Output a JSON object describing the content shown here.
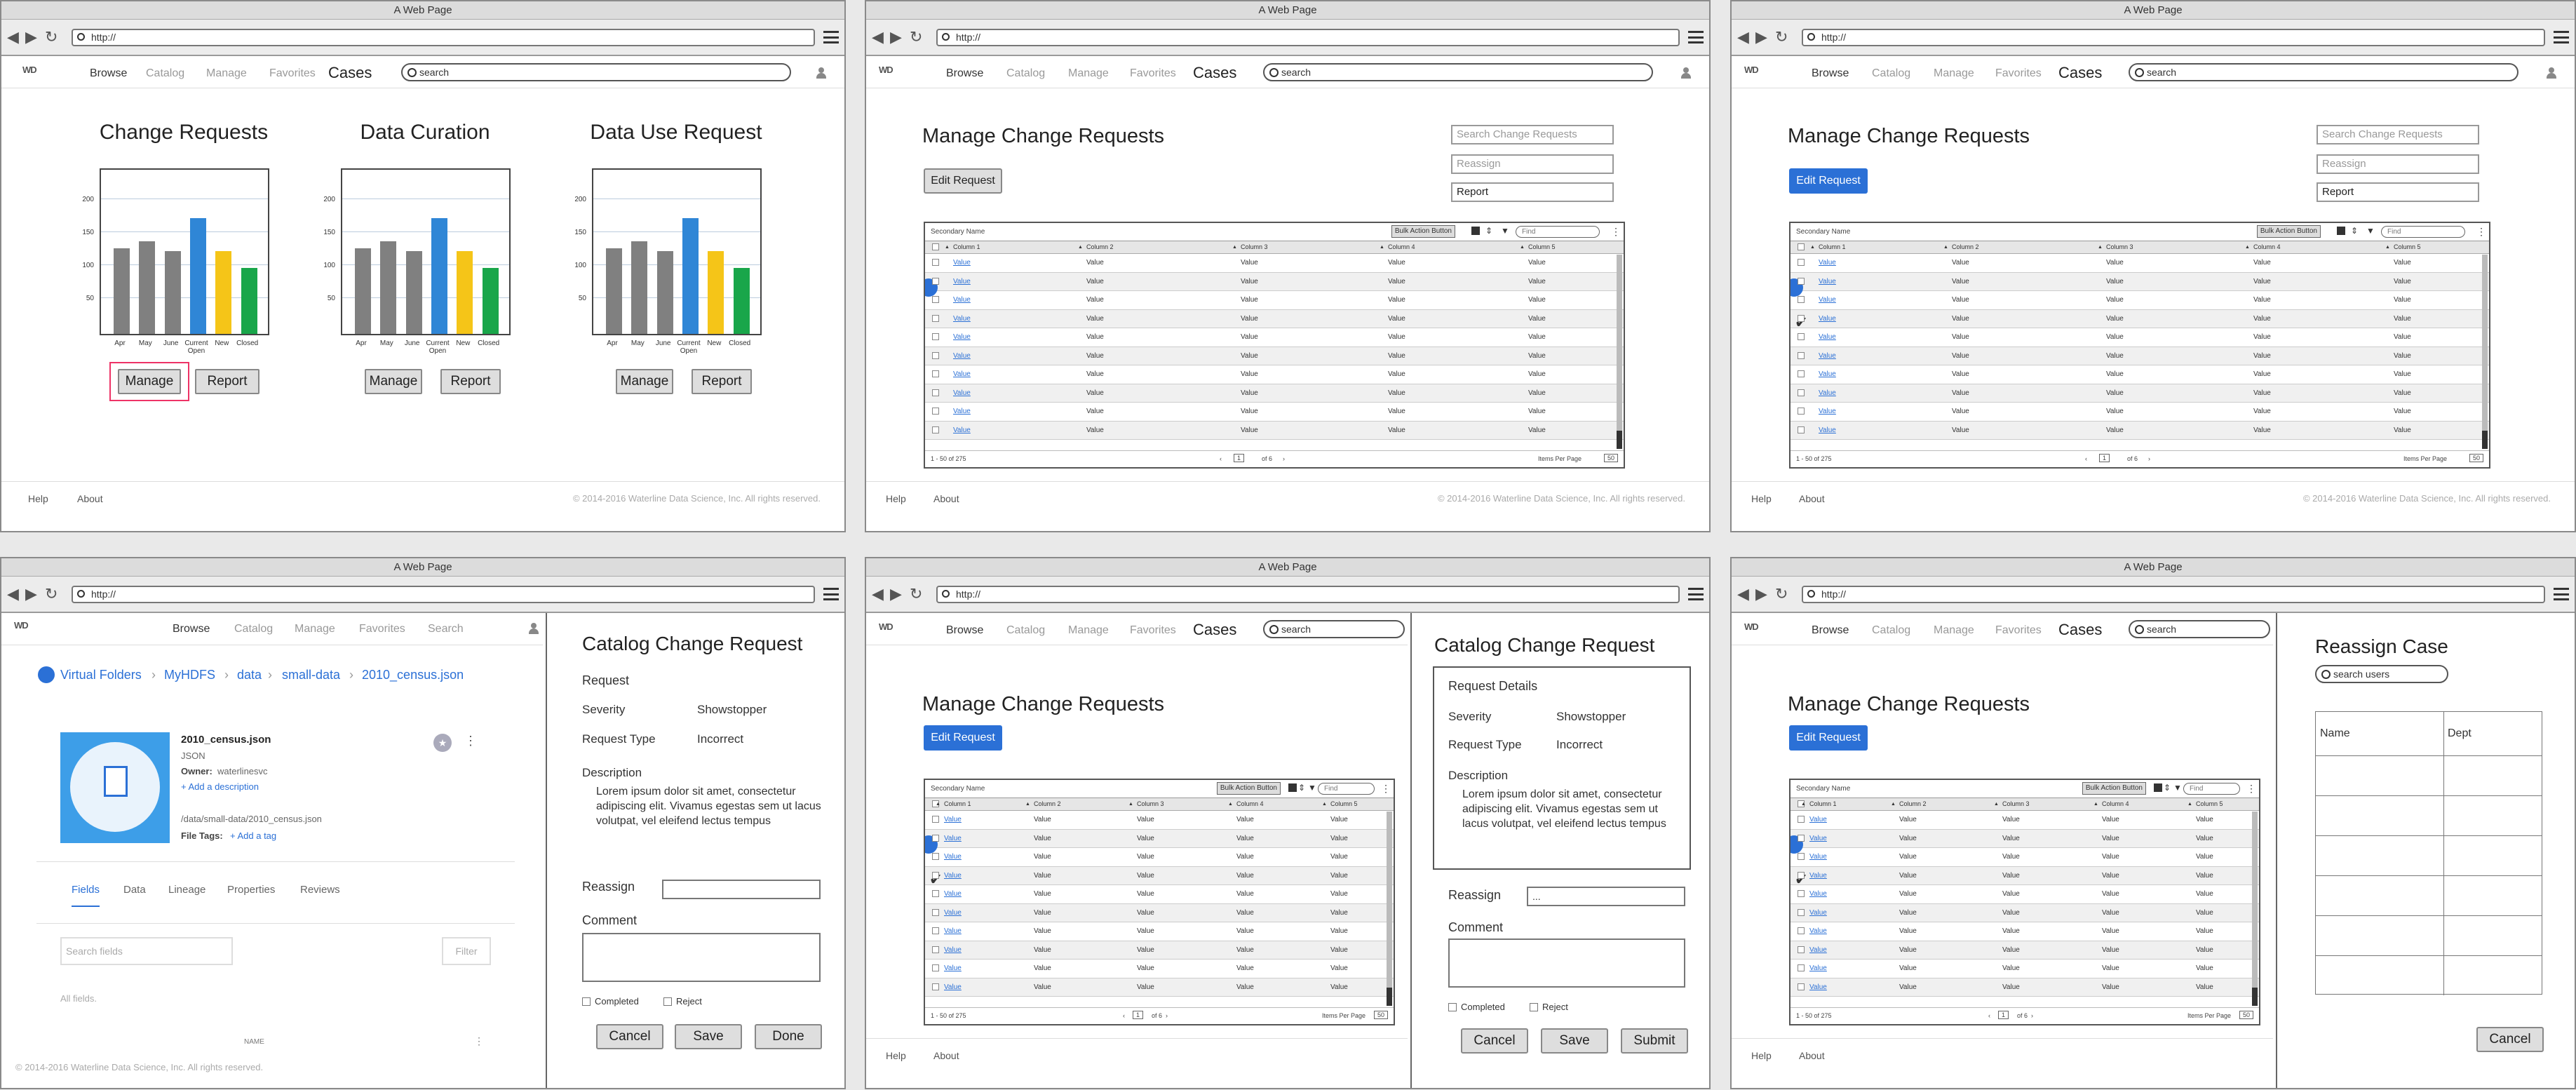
{
  "browser": {
    "title": "A Web Page",
    "url": "http://"
  },
  "nav": {
    "logo": "WD",
    "browse": "Browse",
    "catalog": "Catalog",
    "manage": "Manage",
    "favorites": "Favorites",
    "cases": "Cases",
    "search_label": "Search",
    "search_placeholder": "search"
  },
  "footer": {
    "help": "Help",
    "about": "About",
    "copyright": "© 2014-2016 Waterline Data Science, Inc. All rights reserved."
  },
  "dashboard": {
    "chart_data": [
      {
        "type": "bar",
        "title": "Change Requests",
        "categories": [
          "Apr",
          "May",
          "June",
          "Current Open",
          "New",
          "Closed"
        ],
        "values": [
          130,
          140,
          125,
          175,
          125,
          100
        ],
        "yticks": [
          50,
          100,
          150,
          200
        ],
        "ylim": [
          0,
          240
        ],
        "colors": [
          "#808080",
          "#808080",
          "#808080",
          "#2f86d6",
          "#f5c518",
          "#19a64a"
        ]
      },
      {
        "type": "bar",
        "title": "Data Curation",
        "categories": [
          "Apr",
          "May",
          "June",
          "Current Open",
          "New",
          "Closed"
        ],
        "values": [
          130,
          140,
          125,
          175,
          125,
          100
        ],
        "yticks": [
          50,
          100,
          150,
          200
        ],
        "ylim": [
          0,
          240
        ],
        "colors": [
          "#808080",
          "#808080",
          "#808080",
          "#2f86d6",
          "#f5c518",
          "#19a64a"
        ]
      },
      {
        "type": "bar",
        "title": "Data Use Request",
        "categories": [
          "Apr",
          "May",
          "June",
          "Current Open",
          "New",
          "Closed"
        ],
        "values": [
          130,
          140,
          125,
          175,
          125,
          100
        ],
        "yticks": [
          50,
          100,
          150,
          200
        ],
        "ylim": [
          0,
          240
        ],
        "colors": [
          "#808080",
          "#808080",
          "#808080",
          "#2f86d6",
          "#f5c518",
          "#19a64a"
        ]
      }
    ],
    "manage_label": "Manage",
    "report_label": "Report"
  },
  "manage": {
    "title": "Manage Change Requests",
    "edit_label": "Edit Request",
    "search_cr": "Search Change Requests",
    "reassign": "Reassign",
    "report": "Report",
    "grid": {
      "secondary_name": "Secondary Name",
      "bulk_action": "Bulk Action Button",
      "find": "Find",
      "columns": [
        "Column 1",
        "Column 2",
        "Column 3",
        "Column 4",
        "Column 5"
      ],
      "cell": "Value",
      "range": "1 - 50 of 275",
      "page": "1",
      "of_pages": "of 6",
      "items_per_page": "Items Per Page",
      "per_page": "50"
    }
  },
  "detail": {
    "breadcrumb": [
      "Virtual Folders",
      "MyHDFS",
      "data",
      "small-data",
      "2010_census.json"
    ],
    "file_name": "2010_census.json",
    "file_type": "JSON",
    "owner_label": "Owner:",
    "owner": "waterlinesvc",
    "add_description": "+ Add a description",
    "path": "/data/small-data/2010_census.json",
    "file_tags_label": "File Tags:",
    "add_tag": "+ Add a tag",
    "tabs": [
      "Fields",
      "Data",
      "Lineage",
      "Properties",
      "Reviews"
    ],
    "search_fields": "Search fields",
    "filter": "Filter",
    "all_fields": "All fields.",
    "name_col": "NAME",
    "copyright": "© 2014-2016 Waterline Data Science, Inc. All rights reserved."
  },
  "ccr": {
    "title": "Catalog Change Request",
    "request": "Request",
    "request_details": "Request Details",
    "severity_label": "Severity",
    "severity": "Showstopper",
    "type_label": "Request Type",
    "type": "Incorrect",
    "desc_label": "Description",
    "desc": "Lorem ipsum dolor sit amet, consectetur adipiscing elit. Vivamus egestas sem ut lacus volutpat, vel eleifend lectus tempus",
    "reassign_label": "Reassign",
    "reassign_value": "...",
    "comment_label": "Comment",
    "completed": "Completed",
    "reject": "Reject",
    "cancel": "Cancel",
    "save": "Save",
    "done": "Done",
    "submit": "Submit"
  },
  "reassign": {
    "title": "Reassign Case",
    "search_users": "search users",
    "col_name": "Name",
    "col_dept": "Dept",
    "cancel": "Cancel"
  }
}
